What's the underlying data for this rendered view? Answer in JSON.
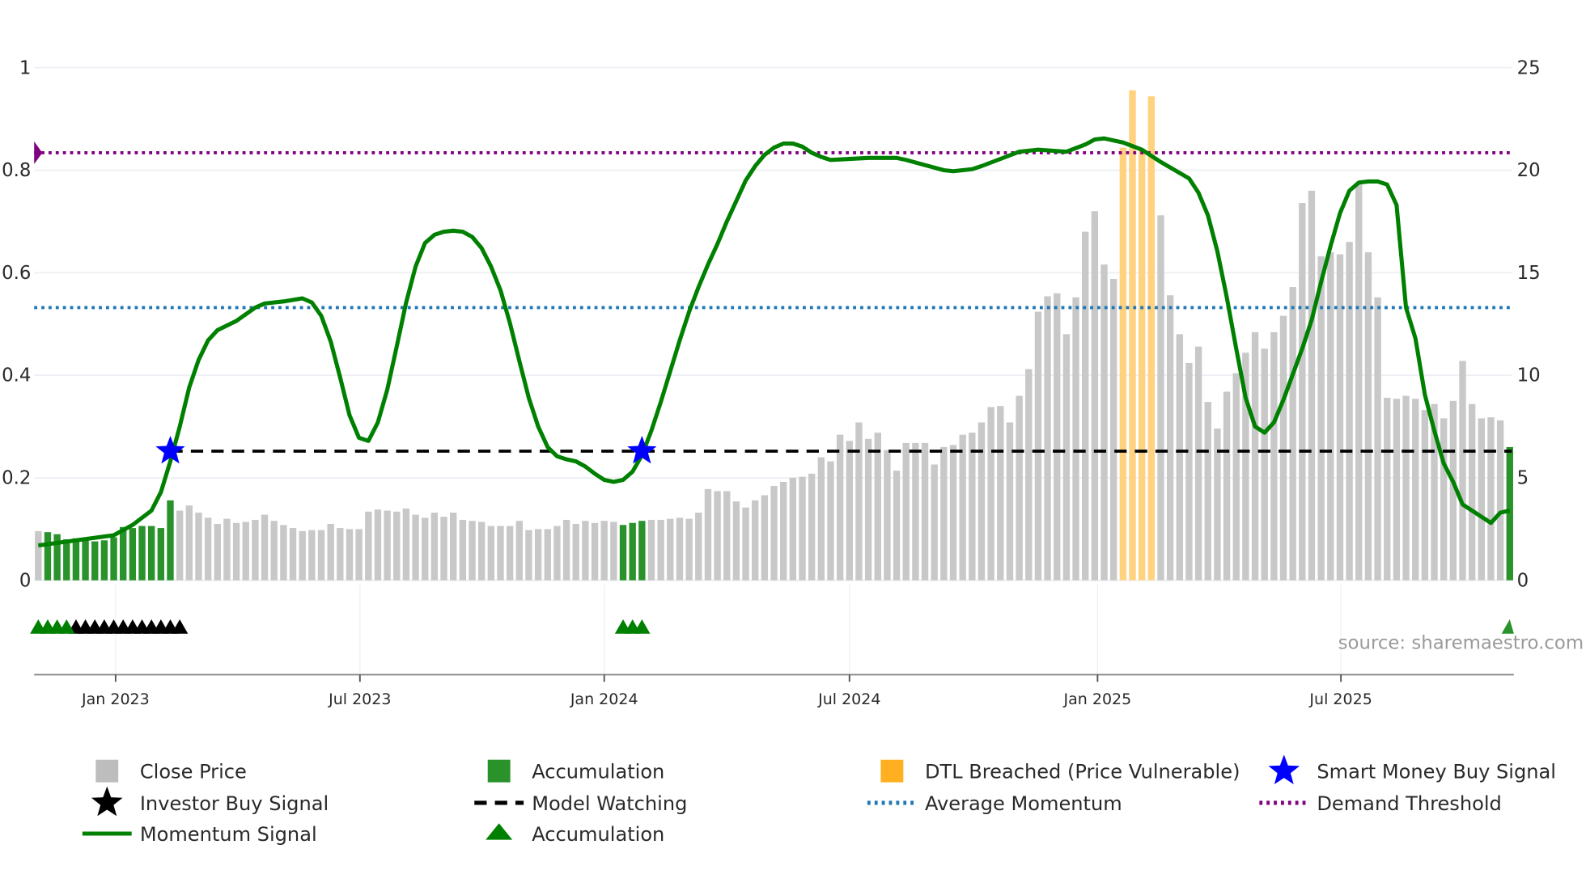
{
  "chart_data": {
    "type": "bar+line",
    "title": "",
    "source": "source: sharemaestro.com",
    "left_axis": {
      "range": [
        0,
        1
      ],
      "ticks": [
        "0",
        "0.2",
        "0.4",
        "0.6",
        "0.8",
        "1"
      ],
      "tick_values": [
        0,
        0.2,
        0.4,
        0.6,
        0.8,
        1
      ]
    },
    "right_axis": {
      "range": [
        0,
        25
      ],
      "ticks": [
        "0",
        "5",
        "10",
        "15",
        "20",
        "25"
      ],
      "tick_values": [
        0,
        5,
        10,
        15,
        20,
        25
      ]
    },
    "x_axis": {
      "interval": "weekly",
      "bar_count": 157,
      "ticks": [
        {
          "label": "Jan 2023",
          "week_index": 8.2
        },
        {
          "label": "Jul 2023",
          "week_index": 34.1
        },
        {
          "label": "Jan 2024",
          "week_index": 60.0
        },
        {
          "label": "Jul 2024",
          "week_index": 86.0
        },
        {
          "label": "Jan 2025",
          "week_index": 112.3
        },
        {
          "label": "Jul 2025",
          "week_index": 138.1
        }
      ]
    },
    "close_price": [
      2.4,
      2.35,
      2.25,
      2.0,
      2.05,
      2.05,
      1.9,
      1.95,
      2.1,
      2.6,
      2.55,
      2.65,
      2.65,
      2.55,
      3.9,
      3.4,
      3.65,
      3.3,
      3.05,
      2.75,
      3.0,
      2.8,
      2.85,
      2.95,
      3.2,
      2.9,
      2.7,
      2.55,
      2.4,
      2.45,
      2.45,
      2.75,
      2.55,
      2.5,
      2.5,
      3.35,
      3.45,
      3.4,
      3.35,
      3.5,
      3.2,
      3.05,
      3.3,
      3.1,
      3.3,
      2.95,
      2.9,
      2.85,
      2.65,
      2.65,
      2.65,
      2.9,
      2.45,
      2.5,
      2.5,
      2.65,
      2.95,
      2.75,
      2.9,
      2.8,
      2.9,
      2.85,
      2.7,
      2.8,
      2.9,
      2.95,
      2.95,
      3.0,
      3.05,
      3.0,
      3.3,
      4.45,
      4.35,
      4.35,
      3.85,
      3.55,
      3.9,
      4.15,
      4.6,
      4.8,
      5.0,
      5.05,
      5.2,
      6.0,
      5.8,
      7.1,
      6.8,
      7.7,
      6.9,
      7.2,
      6.35,
      5.35,
      6.7,
      6.7,
      6.7,
      5.65,
      6.5,
      6.6,
      7.1,
      7.2,
      7.7,
      8.45,
      8.5,
      7.7,
      9.0,
      10.3,
      13.1,
      13.85,
      14.0,
      12.0,
      13.8,
      17.0,
      18.0,
      15.4,
      14.7,
      21.1,
      23.9,
      21.0,
      23.6,
      17.8,
      13.9,
      12.0,
      10.6,
      11.4,
      8.7,
      7.4,
      9.2,
      10.1,
      11.1,
      12.1,
      11.3,
      12.1,
      12.9,
      14.3,
      18.4,
      19.0,
      15.8,
      16.0,
      15.9,
      16.5,
      19.4,
      16.0,
      13.8,
      8.9,
      8.85,
      9.0,
      8.85,
      8.3,
      8.6,
      7.9,
      8.75,
      10.7,
      8.6,
      7.9,
      7.95,
      7.8,
      6.5
    ],
    "accumulation_bar_indices": [
      1,
      2,
      3,
      4,
      5,
      6,
      7,
      8,
      9,
      10,
      11,
      12,
      13,
      14,
      62,
      63,
      64,
      156
    ],
    "dtl_breached_bar_indices": [
      115,
      116,
      117,
      118
    ],
    "momentum_signal": [
      [
        0,
        0.068
      ],
      [
        8,
        0.088
      ],
      [
        10,
        0.108
      ],
      [
        12,
        0.136
      ],
      [
        13,
        0.172
      ],
      [
        14,
        0.232
      ],
      [
        15,
        0.3
      ],
      [
        16,
        0.376
      ],
      [
        17,
        0.43
      ],
      [
        18,
        0.468
      ],
      [
        19,
        0.488
      ],
      [
        21,
        0.506
      ],
      [
        23,
        0.532
      ],
      [
        24,
        0.54
      ],
      [
        26,
        0.544
      ],
      [
        28,
        0.55
      ],
      [
        29,
        0.542
      ],
      [
        30,
        0.516
      ],
      [
        31,
        0.466
      ],
      [
        32,
        0.396
      ],
      [
        33,
        0.322
      ],
      [
        34,
        0.278
      ],
      [
        35,
        0.272
      ],
      [
        36,
        0.308
      ],
      [
        37,
        0.372
      ],
      [
        38,
        0.456
      ],
      [
        39,
        0.542
      ],
      [
        40,
        0.612
      ],
      [
        41,
        0.658
      ],
      [
        42,
        0.674
      ],
      [
        43,
        0.68
      ],
      [
        44,
        0.682
      ],
      [
        45,
        0.68
      ],
      [
        46,
        0.67
      ],
      [
        47,
        0.648
      ],
      [
        48,
        0.612
      ],
      [
        49,
        0.566
      ],
      [
        50,
        0.502
      ],
      [
        51,
        0.428
      ],
      [
        52,
        0.356
      ],
      [
        53,
        0.3
      ],
      [
        54,
        0.26
      ],
      [
        55,
        0.242
      ],
      [
        56,
        0.236
      ],
      [
        57,
        0.232
      ],
      [
        58,
        0.222
      ],
      [
        59,
        0.208
      ],
      [
        60,
        0.196
      ],
      [
        61,
        0.192
      ],
      [
        62,
        0.196
      ],
      [
        63,
        0.212
      ],
      [
        64,
        0.244
      ],
      [
        65,
        0.292
      ],
      [
        66,
        0.348
      ],
      [
        67,
        0.408
      ],
      [
        68,
        0.468
      ],
      [
        69,
        0.524
      ],
      [
        70,
        0.572
      ],
      [
        71,
        0.616
      ],
      [
        72,
        0.656
      ],
      [
        73,
        0.7
      ],
      [
        74,
        0.74
      ],
      [
        75,
        0.78
      ],
      [
        76,
        0.808
      ],
      [
        77,
        0.83
      ],
      [
        78,
        0.844
      ],
      [
        79,
        0.852
      ],
      [
        80,
        0.852
      ],
      [
        81,
        0.846
      ],
      [
        82,
        0.834
      ],
      [
        83,
        0.826
      ],
      [
        84,
        0.82
      ],
      [
        86,
        0.822
      ],
      [
        88,
        0.824
      ],
      [
        91,
        0.824
      ],
      [
        92,
        0.82
      ],
      [
        94,
        0.81
      ],
      [
        96,
        0.8
      ],
      [
        97,
        0.798
      ],
      [
        99,
        0.802
      ],
      [
        100,
        0.808
      ],
      [
        102,
        0.822
      ],
      [
        104,
        0.836
      ],
      [
        106,
        0.84
      ],
      [
        109,
        0.836
      ],
      [
        111,
        0.85
      ],
      [
        112,
        0.86
      ],
      [
        113,
        0.862
      ],
      [
        115,
        0.854
      ],
      [
        117,
        0.84
      ],
      [
        119,
        0.816
      ],
      [
        122,
        0.784
      ],
      [
        123,
        0.756
      ],
      [
        124,
        0.712
      ],
      [
        125,
        0.642
      ],
      [
        126,
        0.552
      ],
      [
        127,
        0.452
      ],
      [
        128,
        0.356
      ],
      [
        129,
        0.3
      ],
      [
        130,
        0.288
      ],
      [
        131,
        0.308
      ],
      [
        132,
        0.352
      ],
      [
        133,
        0.402
      ],
      [
        134,
        0.452
      ],
      [
        135,
        0.508
      ],
      [
        136,
        0.582
      ],
      [
        137,
        0.652
      ],
      [
        138,
        0.716
      ],
      [
        139,
        0.76
      ],
      [
        140,
        0.776
      ],
      [
        141,
        0.778
      ],
      [
        142,
        0.778
      ],
      [
        143,
        0.772
      ],
      [
        144,
        0.732
      ],
      [
        145,
        0.532
      ],
      [
        146,
        0.472
      ],
      [
        147,
        0.362
      ],
      [
        148,
        0.292
      ],
      [
        149,
        0.228
      ],
      [
        150,
        0.192
      ],
      [
        151,
        0.148
      ],
      [
        152,
        0.136
      ],
      [
        153,
        0.124
      ],
      [
        154,
        0.112
      ],
      [
        155,
        0.132
      ],
      [
        156,
        0.136
      ]
    ],
    "demand_threshold": 0.834,
    "average_momentum": 0.532,
    "model_watching": {
      "value": 0.252,
      "from_index": 14
    },
    "smart_money_buy_signals": [
      {
        "index": 14,
        "value": 0.252
      },
      {
        "index": 64,
        "value": 0.252
      }
    ],
    "accumulation_markers": [
      0,
      1,
      2,
      3,
      62,
      63,
      64,
      156
    ],
    "investor_buy_markers": [
      4,
      5,
      6,
      7,
      8,
      9,
      10,
      11,
      12,
      13,
      14,
      15
    ],
    "legend": {
      "placement": "bottom",
      "items": [
        {
          "label": "Close Price",
          "symbol": "gray-square"
        },
        {
          "label": "Accumulation",
          "symbol": "green-square"
        },
        {
          "label": "DTL Breached (Price Vulnerable)",
          "symbol": "orange-square"
        },
        {
          "label": "Smart Money Buy Signal",
          "symbol": "blue-star"
        },
        {
          "label": "Investor Buy Signal",
          "symbol": "black-star"
        },
        {
          "label": "Model Watching",
          "symbol": "black-dashed-line"
        },
        {
          "label": "Average Momentum",
          "symbol": "blue-dotted-line"
        },
        {
          "label": "Demand Threshold",
          "symbol": "purple-dotted-line"
        },
        {
          "label": "Momentum Signal",
          "symbol": "green-line"
        },
        {
          "label": "Accumulation",
          "symbol": "green-triangle"
        }
      ]
    },
    "colors": {
      "close": "#c8c8c8",
      "accum": "#2a922a",
      "dtl": "#ffd27f",
      "momentum": "#008000",
      "star": "#0000ff",
      "black": "#000000",
      "avg": "#1f77b4",
      "demand": "#800080",
      "grid": "#eef0f5"
    }
  }
}
